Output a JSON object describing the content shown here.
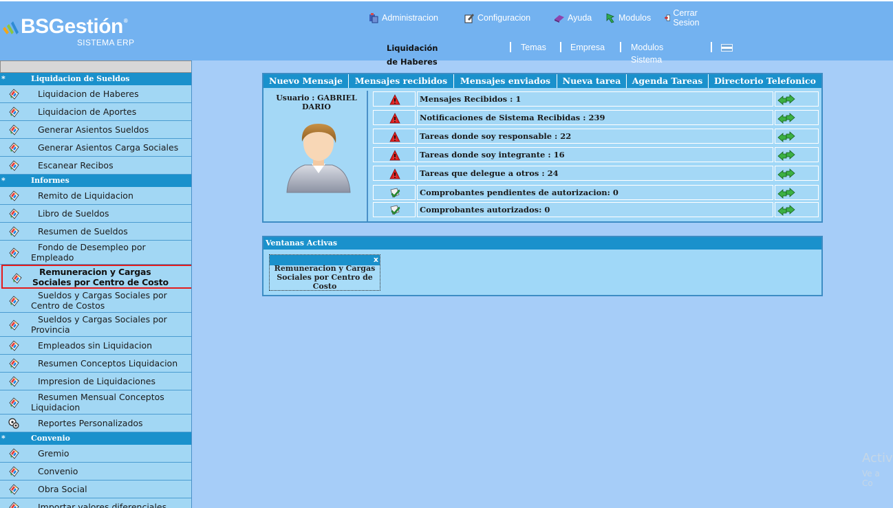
{
  "logo": {
    "brand": "BSGestión",
    "registered": "®",
    "subtitle": "SISTEMA ERP"
  },
  "topnav": [
    {
      "label": "Administracion",
      "icon": "admin-icon"
    },
    {
      "label": "Configuracion",
      "icon": "config-icon"
    },
    {
      "label": "Ayuda",
      "icon": "help-icon"
    },
    {
      "label": "Modulos",
      "icon": "modules-icon"
    },
    {
      "label": "Cerrar Sesion",
      "icon": "logout-icon"
    }
  ],
  "subnav": {
    "module_title": "Liquidación de Haberes",
    "items": [
      "Temas",
      "Empresa",
      "Modulos Sistema"
    ],
    "flag": "argentina-flag-icon"
  },
  "sidebar": {
    "sections": [
      {
        "title": "Liquidacion de Sueldos",
        "star": "*",
        "items": [
          "Liquidacion de Haberes",
          "Liquidacion de Aportes",
          "Generar Asientos Sueldos",
          "Generar Asientos Carga Sociales",
          "Escanear Recibos"
        ]
      },
      {
        "title": "Informes",
        "star": "*",
        "items": [
          "Remito de Liquidacion",
          "Libro de Sueldos",
          "Resumen de Sueldos",
          "Fondo de Desempleo por Empleado",
          "Remuneracion y Cargas Sociales por Centro de Costo",
          "Sueldos y Cargas Sociales por Centro de Costos",
          "Sueldos y Cargas Sociales por Provincia",
          "Empleados sin Liquidacion",
          "Resumen Conceptos Liquidacion",
          "Impresion de Liquidaciones",
          "Resumen Mensual Conceptos Liquidacion",
          "Reportes Personalizados"
        ]
      },
      {
        "title": "Convenio",
        "star": "*",
        "items": [
          "Gremio",
          "Convenio",
          "Obra Social",
          "Importar valores diferenciales"
        ]
      }
    ],
    "active_item": "Remuneracion y Cargas Sociales por Centro de Costo"
  },
  "messages": {
    "tabs": [
      "Nuevo Mensaje",
      "Mensajes recibidos",
      "Mensajes enviados",
      "Nueva tarea",
      "Agenda Tareas",
      "Directorio Telefonico"
    ],
    "user_label": "Usuario : GABRIEL DARIO",
    "rows": [
      {
        "text": "Mensajes Recibidos : 1",
        "icon": "warning-icon"
      },
      {
        "text": "Notificaciones de Sistema Recibidas : 239",
        "icon": "warning-icon"
      },
      {
        "text": "Tareas donde soy responsable : 22",
        "icon": "warning-icon"
      },
      {
        "text": "Tareas donde soy integrante : 16",
        "icon": "warning-icon"
      },
      {
        "text": "Tareas que delegue a otros : 24",
        "icon": "warning-icon"
      },
      {
        "text": "Comprobantes pendientes de autorizacion: 0",
        "icon": "check-icon"
      },
      {
        "text": "Comprobantes autorizados: 0",
        "icon": "check-icon"
      }
    ]
  },
  "active_windows": {
    "title": "Ventanas Activas",
    "windows": [
      {
        "title": "Remuneracion y Cargas Sociales por Centro de Costo",
        "close": "x"
      }
    ]
  },
  "watermark": {
    "line1": "Activ",
    "line2": "Ve a Co"
  },
  "colors": {
    "topbar": "#73b2f0",
    "background": "#a6cdf8",
    "header_blue": "#1a91cc",
    "row_blue": "#a2d7f4",
    "highlight_red": "#e41b1b"
  }
}
